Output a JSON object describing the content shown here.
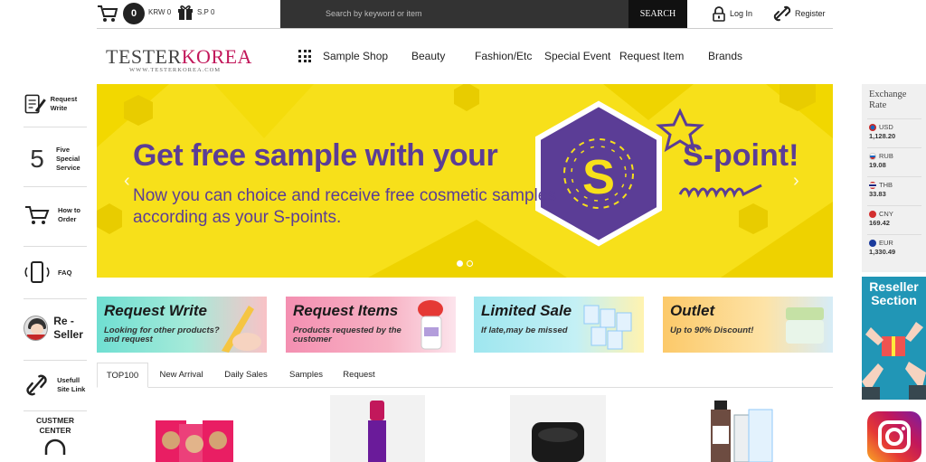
{
  "topbar": {
    "cart_count": "0",
    "krw_label": "KRW 0",
    "sp_label": "S.P 0",
    "search_placeholder": "Search by keyword or item",
    "search_button": "SEARCH",
    "login": "Log In",
    "register": "Register"
  },
  "logo": {
    "main_part1": "TESTER",
    "main_part2": "KOREA",
    "sub": "WWW.TESTERKOREA.COM"
  },
  "nav": {
    "items": [
      "Sample Shop",
      "Beauty",
      "Fashion/Etc",
      "Special Event",
      "Request Item",
      "Brands"
    ]
  },
  "leftbar": {
    "request_write": "Request Write",
    "five_number": "5",
    "five_label": "Five Special Service",
    "how_to_order": "How to Order",
    "faq": "FAQ",
    "reseller": "Re - Seller",
    "useful_link": "Usefull Site Link",
    "customer_center": "CUSTMER CENTER"
  },
  "banner": {
    "headline": "Get free sample with your",
    "headline_right": "S-point!",
    "sub": "Now you can choice and receive free cosmetic samples according as your S-points.",
    "badge_letter": "S",
    "prev_arrow": "‹",
    "next_arrow": "›"
  },
  "promos": [
    {
      "title": "Request Write",
      "sub": "Looking for other products? and request",
      "color": "#7fe0d6"
    },
    {
      "title": "Request Items",
      "sub": "Products requested by the customer",
      "color": "#f9a0b8"
    },
    {
      "title": "Limited Sale",
      "sub": "If late,may be missed",
      "color": "#a8e6f0"
    },
    {
      "title": "Outlet",
      "sub": "Up to 90% Discount!",
      "color": "#fcd68a"
    }
  ],
  "tabs": [
    "TOP100",
    "New Arrival",
    "Daily Sales",
    "Samples",
    "Request"
  ],
  "rightbar": {
    "title": "Exchange Rate",
    "rates": [
      {
        "code": "USD",
        "value": "1,128.20"
      },
      {
        "code": "RUB",
        "value": "19.08"
      },
      {
        "code": "THB",
        "value": "33.83"
      },
      {
        "code": "CNY",
        "value": "169.42"
      },
      {
        "code": "EUR",
        "value": "1,330.49"
      }
    ],
    "reseller_title": "Reseller Section"
  },
  "colors": {
    "banner_yellow": "#f7e01a",
    "brand_purple": "#5b3d96",
    "logo_pink": "#c2185b",
    "search_dark": "#333333"
  }
}
